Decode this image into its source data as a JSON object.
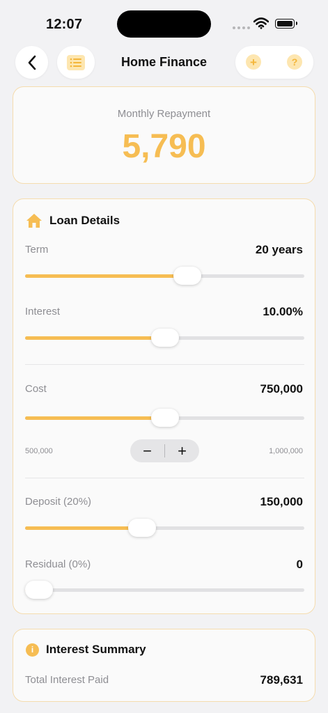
{
  "status_bar": {
    "time": "12:07"
  },
  "nav": {
    "title": "Home Finance",
    "add_label": "+",
    "help_label": "?"
  },
  "repayment": {
    "label": "Monthly Repayment",
    "value": "5,790"
  },
  "loan_details": {
    "title": "Loan Details",
    "term": {
      "label": "Term",
      "value": "20 years",
      "slider_fraction": 0.59
    },
    "interest": {
      "label": "Interest",
      "value": "10.00%",
      "slider_fraction": 0.5
    },
    "cost": {
      "label": "Cost",
      "value": "750,000",
      "slider_fraction": 0.5,
      "min": "500,000",
      "max": "1,000,000"
    },
    "stepper": {
      "minus": "−",
      "plus": "+"
    },
    "deposit": {
      "label": "Deposit (20%)",
      "value": "150,000",
      "slider_fraction": 0.41
    },
    "residual": {
      "label": "Residual (0%)",
      "value": "0",
      "slider_fraction": 0.0
    }
  },
  "interest_summary": {
    "title": "Interest Summary",
    "total_label": "Total Interest Paid",
    "total_value": "789,631"
  },
  "colors": {
    "accent": "#f6bd53",
    "accent_light": "#fde6b0",
    "card_border": "#f5dcae"
  }
}
